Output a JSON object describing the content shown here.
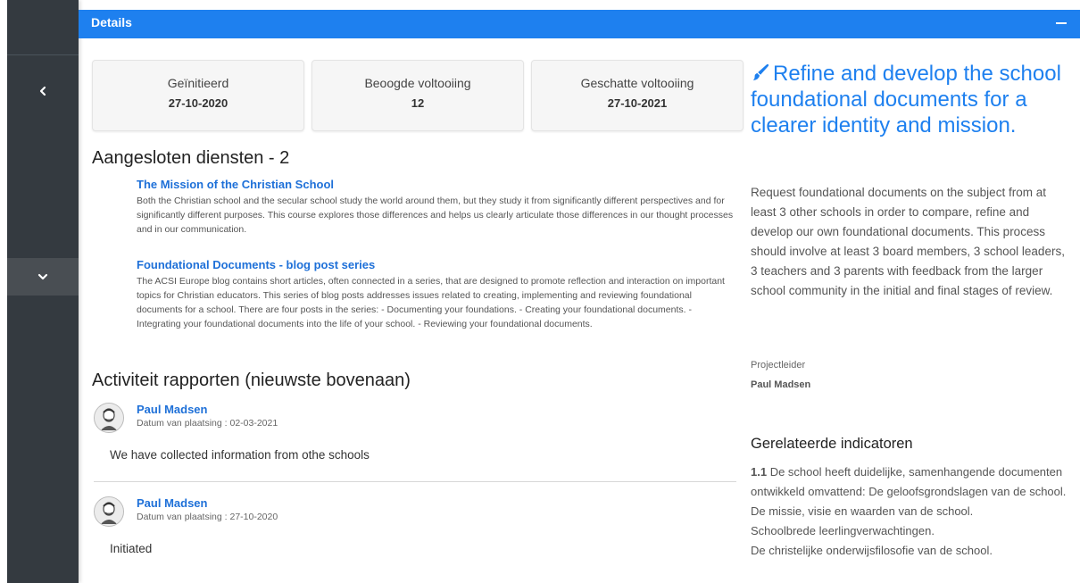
{
  "card": {
    "title": "Details"
  },
  "stats": [
    {
      "label": "Geïnitieerd",
      "value": "27-10-2020"
    },
    {
      "label": "Beoogde voltooiing",
      "value": "12"
    },
    {
      "label": "Geschatte voltooiing",
      "value": "27-10-2021"
    }
  ],
  "services": {
    "heading": "Aangesloten diensten - 2",
    "items": [
      {
        "title": "The Mission of the Christian School",
        "description": "Both the Christian school and the secular school study the world around them, but they study it from significantly different perspectives and for significantly different purposes. This course explores those differences and helps us clearly articulate those differences in our thought processes and in our communication."
      },
      {
        "title": "Foundational Documents - blog post series",
        "description": "The ACSI Europe blog contains short articles, often connected in a series, that are designed to promote reflection and interaction on important topics for Christian educators. This series of blog posts addresses issues related to creating, implementing and reviewing foundational documents for a school. There are four posts in the series: - Documenting your foundations. - Creating your foundational documents. - Integrating your foundational documents into the life of your school. - Reviewing your foundational documents."
      }
    ]
  },
  "reports": {
    "heading": "Activiteit rapporten (nieuwste bovenaan)",
    "items": [
      {
        "author": "Paul Madsen",
        "date_label": "Datum van plaatsing : ",
        "date": "02-03-2021",
        "text": "We have collected information from othe schools"
      },
      {
        "author": "Paul Madsen",
        "date_label": "Datum van plaatsing : ",
        "date": "27-10-2020",
        "text": "Initiated"
      }
    ]
  },
  "goal": {
    "title": "Refine and develop the school foundational documents for a clearer identity and mission.",
    "description": "Request foundational documents on the subject from at least 3 other schools in order to compare, refine and develop our own foundational documents. This process should involve at least 3 board members, 3 school leaders, 3 teachers and 3 parents with feedback from the larger school community in the initial and final stages of review."
  },
  "project_leader": {
    "label": "Projectleider",
    "name": "Paul Madsen"
  },
  "indicators": {
    "heading": "Gerelateerde indicatoren",
    "number": "1.1",
    "lines": [
      "De school heeft duidelijke, samenhangende documenten ontwikkeld omvattend: De geloofsgrondslagen van de school.",
      "De missie, visie en waarden van de school.",
      "Schoolbrede leerlingverwachtingen.",
      "De christelijke onderwijsfilosofie van de school."
    ]
  },
  "icons": {
    "sidebar_collapse": "chevron-left-icon",
    "sidebar_expand": "chevron-down-icon",
    "card_collapse": "minus-icon",
    "goal": "paint-brush-icon",
    "avatar": "user-avatar-icon"
  },
  "colors": {
    "accent": "#1e80ef",
    "sidebar": "#343a40",
    "link": "#1e70d8"
  }
}
